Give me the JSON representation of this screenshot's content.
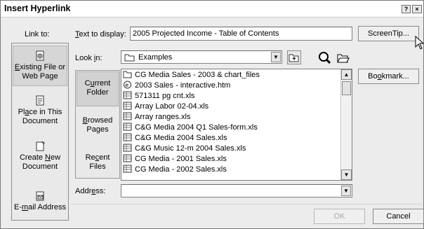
{
  "dialog": {
    "title": "Insert Hyperlink",
    "help_glyph": "?",
    "close_glyph": "×"
  },
  "link_to": {
    "label": "Link to:",
    "items": [
      {
        "pre": "",
        "u": "E",
        "post": "xisting File or",
        "line2": "Web Page"
      },
      {
        "pre": "Pl",
        "u": "a",
        "post": "ce in This",
        "line2": "Document"
      },
      {
        "pre": "Create ",
        "u": "N",
        "post": "ew",
        "line2": "Document"
      },
      {
        "pre": "E-",
        "u": "m",
        "post": "ail Address",
        "line2": ""
      }
    ]
  },
  "text_to_display": {
    "label_u": "T",
    "label_rest": "ext to display:",
    "value": "2005 Projected Income - Table of Contents"
  },
  "screentip_button": "ScreenTip...",
  "look_in": {
    "label_pre": "Look ",
    "label_u": "i",
    "label_post": "n:",
    "value": "Examples"
  },
  "bookmark_button": {
    "pre": "Bo",
    "u": "o",
    "post": "kmark..."
  },
  "subnav": [
    {
      "pre": "C",
      "u": "u",
      "post": "rrent",
      "line2": "Folder"
    },
    {
      "pre": "",
      "u": "B",
      "post": "rowsed",
      "line2": "Pages"
    },
    {
      "pre": "Re",
      "u": "c",
      "post": "ent",
      "line2": "Files"
    }
  ],
  "files": [
    {
      "name": "CG Media Sales - 2003 & chart_files",
      "icon": "folder-icon"
    },
    {
      "name": "2003 Sales - interactive.htm",
      "icon": "web-page-icon"
    },
    {
      "name": "571311 pg cnt.xls",
      "icon": "spreadsheet-icon"
    },
    {
      "name": "Array Labor 02-04.xls",
      "icon": "spreadsheet-icon"
    },
    {
      "name": "Array ranges.xls",
      "icon": "spreadsheet-icon"
    },
    {
      "name": "C&G Media 2004 Q1 Sales-form.xls",
      "icon": "spreadsheet-icon"
    },
    {
      "name": "C&G Media 2004 Sales.xls",
      "icon": "spreadsheet-icon"
    },
    {
      "name": "C&G Music 12-m 2004 Sales.xls",
      "icon": "spreadsheet-icon"
    },
    {
      "name": "CG Media - 2001 Sales.xls",
      "icon": "spreadsheet-icon"
    },
    {
      "name": "CG Media - 2002 Sales.xls",
      "icon": "spreadsheet-icon"
    }
  ],
  "address": {
    "label_pre": "Addr",
    "label_u": "e",
    "label_post": "ss:",
    "value": ""
  },
  "ok_button": "OK",
  "cancel_button": "Cancel"
}
